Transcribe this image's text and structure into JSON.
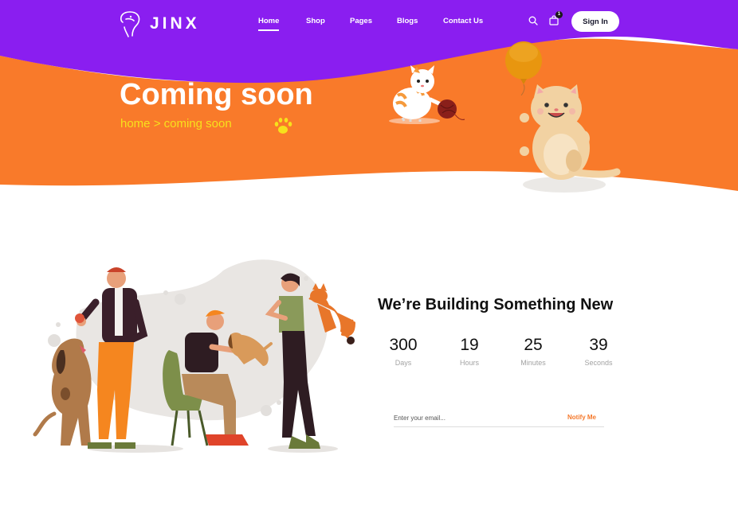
{
  "brand": {
    "name": "JINX"
  },
  "nav": {
    "items": [
      {
        "label": "Home",
        "active": true
      },
      {
        "label": "Shop",
        "active": false
      },
      {
        "label": "Pages",
        "active": false
      },
      {
        "label": "Blogs",
        "active": false
      },
      {
        "label": "Contact Us",
        "active": false
      }
    ]
  },
  "header": {
    "cart_count": "1",
    "signin_label": "Sign In",
    "search_icon": "search-icon",
    "cart_icon": "shopping-bag-icon"
  },
  "hero": {
    "title": "Coming soon",
    "breadcrumb": "home > coming soon"
  },
  "countdown": {
    "heading": "We’re Building Something New",
    "units": [
      {
        "value": "300",
        "label": "Days"
      },
      {
        "value": "19",
        "label": "Hours"
      },
      {
        "value": "25",
        "label": "Minutes"
      },
      {
        "value": "39",
        "label": "Seconds"
      }
    ]
  },
  "subscribe": {
    "placeholder": "Enter your email...",
    "button_label": "Notify Me"
  },
  "colors": {
    "purple": "#8a1ef0",
    "orange": "#f97a2a",
    "yellow": "#f7e11c",
    "notify": "#f5782a"
  }
}
